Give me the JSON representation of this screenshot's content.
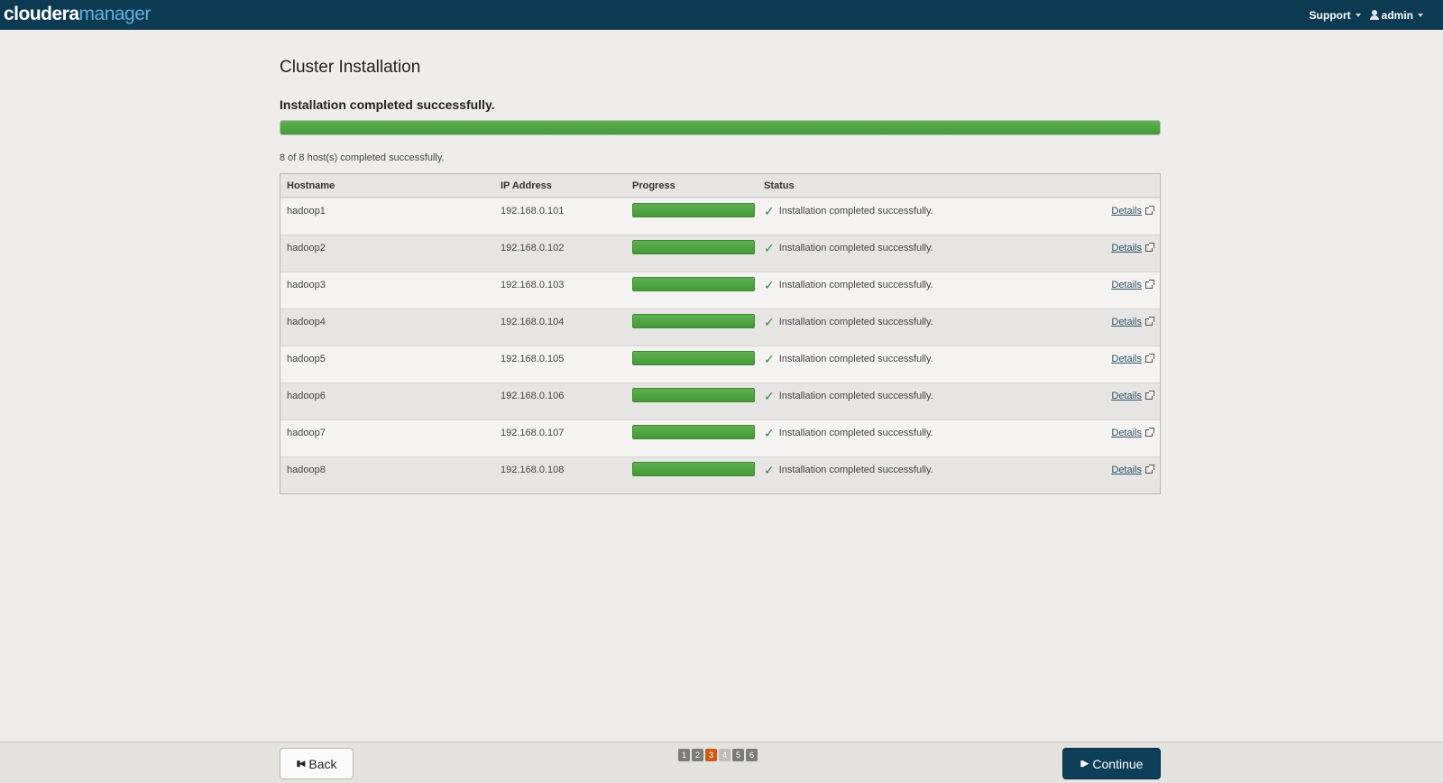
{
  "nav": {
    "brand_primary": "cloudera",
    "brand_secondary": "manager",
    "support_label": "Support",
    "user_label": "admin"
  },
  "page": {
    "title": "Cluster Installation",
    "status_heading": "Installation completed successfully.",
    "overall_progress_percent": 100,
    "summary": "8 of 8 host(s) completed successfully."
  },
  "table": {
    "headers": {
      "hostname": "Hostname",
      "ip": "IP Address",
      "progress": "Progress",
      "status": "Status"
    },
    "rows": [
      {
        "hostname": "hadoop1",
        "ip": "192.168.0.101",
        "progress_percent": 100,
        "status": "Installation completed successfully.",
        "details": "Details"
      },
      {
        "hostname": "hadoop2",
        "ip": "192.168.0.102",
        "progress_percent": 100,
        "status": "Installation completed successfully.",
        "details": "Details"
      },
      {
        "hostname": "hadoop3",
        "ip": "192.168.0.103",
        "progress_percent": 100,
        "status": "Installation completed successfully.",
        "details": "Details"
      },
      {
        "hostname": "hadoop4",
        "ip": "192.168.0.104",
        "progress_percent": 100,
        "status": "Installation completed successfully.",
        "details": "Details"
      },
      {
        "hostname": "hadoop5",
        "ip": "192.168.0.105",
        "progress_percent": 100,
        "status": "Installation completed successfully.",
        "details": "Details"
      },
      {
        "hostname": "hadoop6",
        "ip": "192.168.0.106",
        "progress_percent": 100,
        "status": "Installation completed successfully.",
        "details": "Details"
      },
      {
        "hostname": "hadoop7",
        "ip": "192.168.0.107",
        "progress_percent": 100,
        "status": "Installation completed successfully.",
        "details": "Details"
      },
      {
        "hostname": "hadoop8",
        "ip": "192.168.0.108",
        "progress_percent": 100,
        "status": "Installation completed successfully.",
        "details": "Details"
      }
    ]
  },
  "footer": {
    "back_label": "Back",
    "continue_label": "Continue",
    "steps": [
      "1",
      "2",
      "3",
      "4",
      "5",
      "6"
    ],
    "active_step": 3
  },
  "colors": {
    "navbar": "#0b3a52",
    "brand_accent": "#62b0dc",
    "progress_green": "#4aa13c",
    "active_step": "#cc5a14",
    "continue_button": "#0e3f59"
  },
  "icons": {
    "user": "user-icon",
    "check": "checkmark-icon",
    "external": "external-link-icon",
    "back": "step-backward-icon",
    "continue": "step-forward-icon"
  }
}
